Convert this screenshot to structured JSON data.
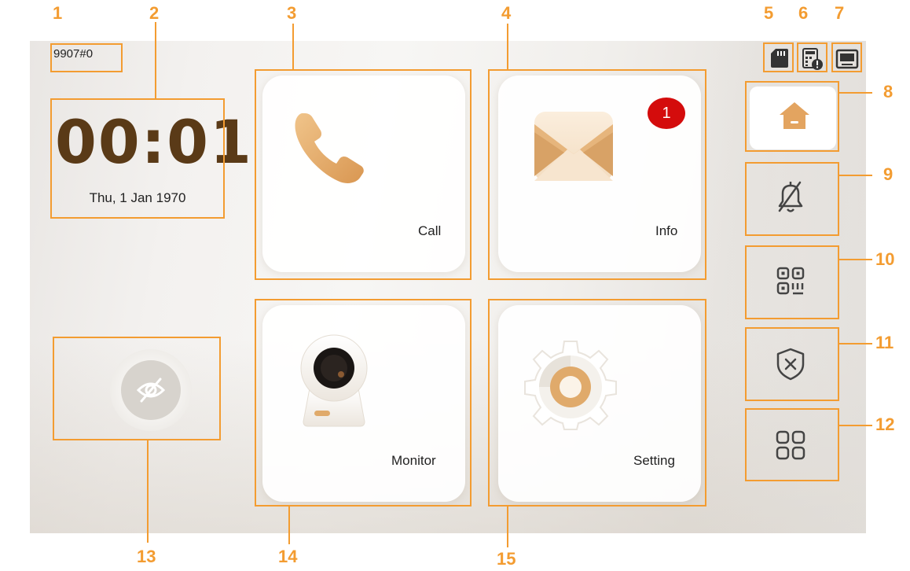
{
  "device_id": "9907#0",
  "clock": {
    "time": "00:01",
    "date": "Thu, 1 Jan 1970"
  },
  "tiles": {
    "call": "Call",
    "info": "Info",
    "info_badge": "1",
    "monitor": "Monitor",
    "setting": "Setting"
  },
  "status_icons": [
    "sd-card-icon",
    "device-alert-icon",
    "monitor-screen-icon"
  ],
  "sidebar": [
    "home-icon",
    "mute-bell-icon",
    "qr-code-icon",
    "shield-x-icon",
    "apps-grid-icon"
  ],
  "callouts": [
    "1",
    "2",
    "3",
    "4",
    "5",
    "6",
    "7",
    "8",
    "9",
    "10",
    "11",
    "12",
    "13",
    "14",
    "15"
  ],
  "colors": {
    "callout": "#f39c31",
    "accent": "#e0aa6b",
    "clock": "#5a3a17",
    "badge": "#d40c0c"
  }
}
